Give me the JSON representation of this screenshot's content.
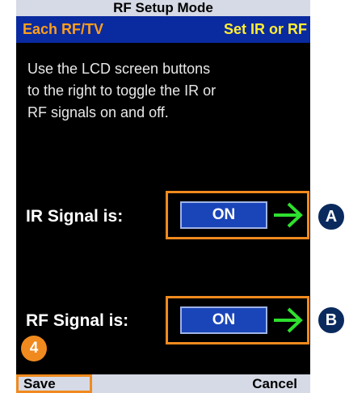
{
  "screen": {
    "title": "RF Setup Mode",
    "left_header": "Each RF/TV",
    "right_header": "Set IR or RF",
    "instructions": [
      "Use the LCD screen buttons",
      "to the right to toggle the IR or",
      "RF signals on and off."
    ]
  },
  "ir": {
    "label": "IR Signal is:",
    "state": "ON"
  },
  "rf": {
    "label": "RF Signal is:",
    "state": "ON"
  },
  "callouts": {
    "a": "A",
    "b": "B",
    "step": "4"
  },
  "footer": {
    "save": "Save",
    "cancel": "Cancel"
  },
  "colors": {
    "header_bg": "#0a2aa0",
    "left_header_text": "#ff9f1a",
    "right_header_text": "#ffee33",
    "highlight": "#f08a1e",
    "arrow": "#2ee02e",
    "button_bg": "#1a45b8"
  },
  "icons": {
    "arrow": "right-arrow-icon"
  }
}
